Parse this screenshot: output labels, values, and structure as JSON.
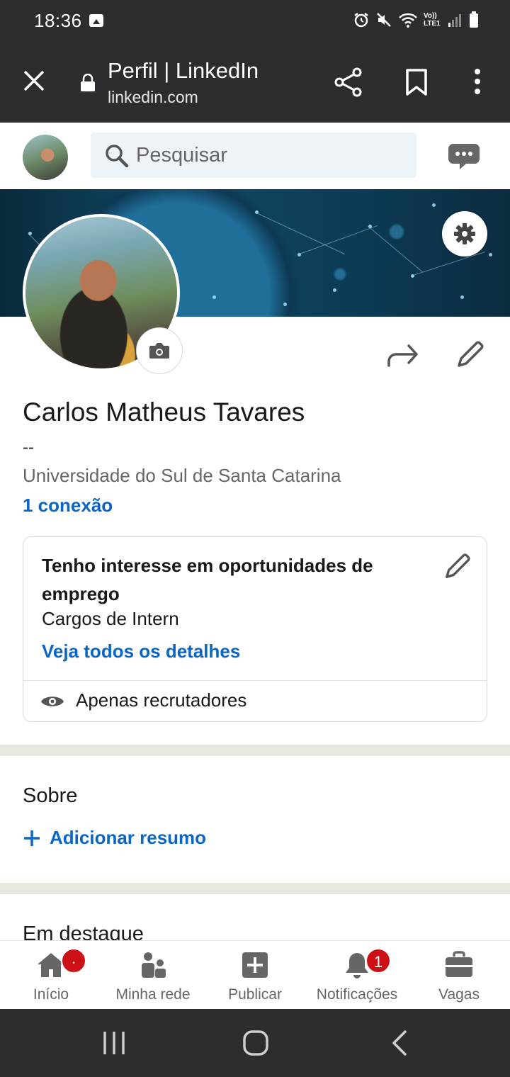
{
  "status_bar": {
    "time": "18:36",
    "network_label": "Vo)) LTE1"
  },
  "browser": {
    "title": "Perfil | LinkedIn",
    "url": "linkedin.com"
  },
  "linkedin_header": {
    "search_placeholder": "Pesquisar"
  },
  "profile": {
    "name": "Carlos Matheus Tavares",
    "headline": "--",
    "school": "Universidade do Sul de Santa Catarina",
    "connections": "1 conexão"
  },
  "open_to_work": {
    "title": "Tenho interesse em oportunidades de emprego",
    "roles": "Cargos de Intern",
    "details_link": "Veja todos os detalhes",
    "visibility": "Apenas recrutadores"
  },
  "about": {
    "title": "Sobre",
    "add_summary": "Adicionar resumo"
  },
  "featured": {
    "title": "Em destaque"
  },
  "bottom_nav": {
    "items": [
      {
        "label": "Início",
        "badge": "·"
      },
      {
        "label": "Minha rede",
        "badge": ""
      },
      {
        "label": "Publicar",
        "badge": ""
      },
      {
        "label": "Notificações",
        "badge": "1"
      },
      {
        "label": "Vagas",
        "badge": ""
      }
    ]
  },
  "colors": {
    "linkedin_blue": "#0a66c2",
    "system_bar": "#2b2d30",
    "badge_red": "#cc1016"
  }
}
